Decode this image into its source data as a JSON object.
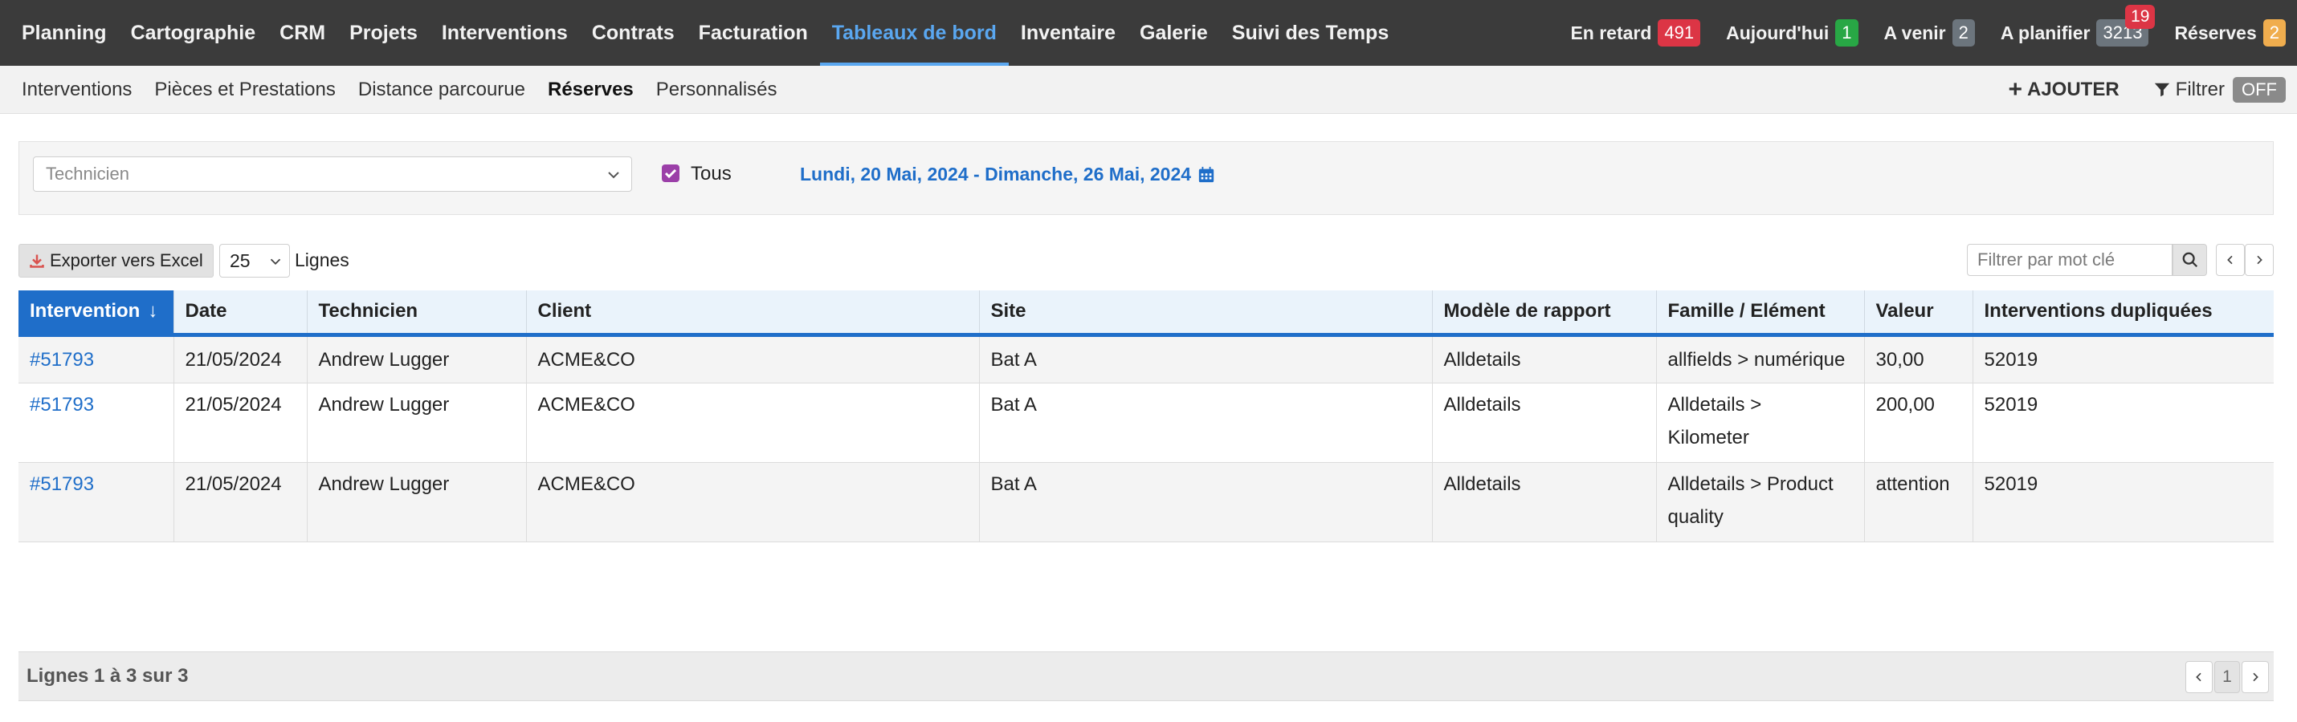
{
  "topnav": {
    "menu": [
      {
        "label": "Planning",
        "active": false
      },
      {
        "label": "Cartographie",
        "active": false
      },
      {
        "label": "CRM",
        "active": false
      },
      {
        "label": "Projets",
        "active": false
      },
      {
        "label": "Interventions",
        "active": false
      },
      {
        "label": "Contrats",
        "active": false
      },
      {
        "label": "Facturation",
        "active": false
      },
      {
        "label": "Tableaux de bord",
        "active": true
      },
      {
        "label": "Inventaire",
        "active": false
      },
      {
        "label": "Galerie",
        "active": false
      },
      {
        "label": "Suivi des Temps",
        "active": false
      }
    ],
    "counters": {
      "late": {
        "label": "En retard",
        "value": "491",
        "color": "#dc3545"
      },
      "today": {
        "label": "Aujourd'hui",
        "value": "1",
        "color": "#28a745"
      },
      "upcoming": {
        "label": "A venir",
        "value": "2",
        "color": "#6c757d"
      },
      "to_plan": {
        "label": "A planifier",
        "value": "3213",
        "color": "#6c757d",
        "notification": "19"
      },
      "reserves": {
        "label": "Réserves",
        "value": "2",
        "color": "#f0ad4e"
      }
    }
  },
  "subnav": {
    "tabs": [
      {
        "label": "Interventions",
        "active": false
      },
      {
        "label": "Pièces et Prestations",
        "active": false
      },
      {
        "label": "Distance parcourue",
        "active": false
      },
      {
        "label": "Réserves",
        "active": true
      },
      {
        "label": "Personnalisés",
        "active": false
      }
    ],
    "add_label": "AJOUTER",
    "filter_label": "Filtrer",
    "filter_state": "OFF"
  },
  "filters": {
    "technician_placeholder": "Technicien",
    "all_label": "Tous",
    "all_checked": true,
    "date_range": "Lundi, 20 Mai, 2024 - Dimanche, 26 Mai, 2024"
  },
  "toolbar": {
    "export_label": "Exporter vers Excel",
    "page_size": "25",
    "page_size_label": "Lignes",
    "search_placeholder": "Filtrer par mot clé"
  },
  "table": {
    "columns": [
      "Intervention",
      "Date",
      "Technicien",
      "Client",
      "Site",
      "Modèle de rapport",
      "Famille / Elément",
      "Valeur",
      "Interventions dupliquées"
    ],
    "sort_indicator": "↓",
    "rows": [
      {
        "intervention": "#51793",
        "date": "21/05/2024",
        "technician": "Andrew Lugger",
        "client": "ACME&CO",
        "site": "Bat A",
        "model": "Alldetails",
        "family_l1": "allfields > numérique",
        "family_l2": "",
        "value": "30,00",
        "duplicated": "52019"
      },
      {
        "intervention": "#51793",
        "date": "21/05/2024",
        "technician": "Andrew Lugger",
        "client": "ACME&CO",
        "site": "Bat A",
        "model": "Alldetails",
        "family_l1": "Alldetails >",
        "family_l2": "Kilometer",
        "value": "200,00",
        "duplicated": "52019"
      },
      {
        "intervention": "#51793",
        "date": "21/05/2024",
        "technician": "Andrew Lugger",
        "client": "ACME&CO",
        "site": "Bat A",
        "model": "Alldetails",
        "family_l1": "Alldetails > Product",
        "family_l2": "quality",
        "value": "attention",
        "duplicated": "52019"
      }
    ]
  },
  "footer": {
    "info": "Lignes 1 à 3 sur 3",
    "current_page": "1"
  },
  "colors": {
    "accent": "#1f6ec9",
    "nav_bg": "#3b3b3b",
    "nav_active": "#5aa7f0",
    "checkbox": "#9b3fa8"
  }
}
